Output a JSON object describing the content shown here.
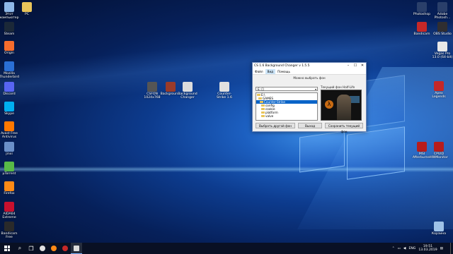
{
  "desktop_icons_left": [
    {
      "label": "Этот\nкомпьютер",
      "icon": "computer-icon",
      "color": "#8fb8e8"
    },
    {
      "label": "Steam",
      "icon": "steam-icon",
      "color": "#1b2838"
    },
    {
      "label": "Origin",
      "icon": "origin-icon",
      "color": "#f56c2d"
    },
    {
      "label": "Mozilla\nThunderbird",
      "icon": "thunderbird-icon",
      "color": "#2a6fd6"
    },
    {
      "label": "Discord",
      "icon": "discord-icon",
      "color": "#5865f2"
    },
    {
      "label": "Skype",
      "icon": "skype-icon",
      "color": "#00aff0"
    },
    {
      "label": "Avast Free\nAntivirus",
      "icon": "avast-icon",
      "color": "#ff7800"
    },
    {
      "label": "jinxi",
      "icon": "app-icon",
      "color": "#6a8fc8"
    },
    {
      "label": "µTorrent",
      "icon": "utorrent-icon",
      "color": "#58b947"
    },
    {
      "label": "Firefox",
      "icon": "firefox-icon",
      "color": "#ff8a16"
    },
    {
      "label": "AIDA64\nExtreme",
      "icon": "aida64-icon",
      "color": "#c8102e"
    },
    {
      "label": "Bandicam\nFree",
      "icon": "bandicam-icon",
      "color": "#2a2a2a"
    }
  ],
  "desktop_icon_pc": {
    "label": "PC",
    "icon": "folder-icon",
    "color": "#e8c45a"
  },
  "desktop_icons_middle": [
    {
      "label": "CSFON\n1024x768",
      "icon": "image-file-icon",
      "color": "#555555"
    },
    {
      "label": "Backgroun...",
      "icon": "archive-icon",
      "color": "#9a3b2a"
    },
    {
      "label": "Background\nChanger",
      "icon": "document-icon",
      "color": "#dcdcdc"
    },
    {
      "label": "Counter-\nStrike 1.6",
      "icon": "counter-strike-icon",
      "color": "#e0e0e0"
    }
  ],
  "desktop_icons_right": [
    {
      "label": "Photoshop",
      "icon": "photoshop-icon",
      "color": "#2a3f6a"
    },
    {
      "label": "Adobe\nPhotosh...",
      "icon": "photoshop-icon",
      "color": "#2a3f6a"
    },
    {
      "label": "Bandicam",
      "icon": "bandicam-icon",
      "color": "#c62828"
    },
    {
      "label": "OBS Studio",
      "icon": "obs-icon",
      "color": "#302e31"
    },
    {
      "label": "Vegas Pro\n13.0 (64-bit)",
      "icon": "vegas-icon",
      "color": "#e8e8e8"
    },
    {
      "label": "Apex\nLegends",
      "icon": "apex-icon",
      "color": "#c62828"
    },
    {
      "label": "MSI\nAfterburner",
      "icon": "afterburner-icon",
      "color": "#b71c1c"
    },
    {
      "label": "CPUID\nHWMonitor",
      "icon": "hwmonitor-icon",
      "color": "#b71c1c"
    },
    {
      "label": "Корзина",
      "icon": "recycle-bin-icon",
      "color": "#9fc3e8"
    }
  ],
  "window": {
    "title": "CS 1.6 Background Changer v 1.5.5",
    "minimize": "–",
    "maximize": "☐",
    "close": "✕",
    "menu": [
      "Файл",
      "Вид",
      "Помощь"
    ],
    "header": "Можно выбрать фон",
    "drive": "E: []",
    "tree": [
      "E:\\",
      "GAMES",
      "Counter-Strike",
      "config",
      "cookie",
      "platform",
      "valve"
    ],
    "tree_selected": 2,
    "preview_label": "Текущий фон Half-Life",
    "buttons": [
      "Выбрать другой фон",
      "Выход",
      "Сохранить текущий фон"
    ]
  },
  "tray": {
    "lang": "ENG",
    "time": "19:51",
    "date": "13.03.2019"
  }
}
